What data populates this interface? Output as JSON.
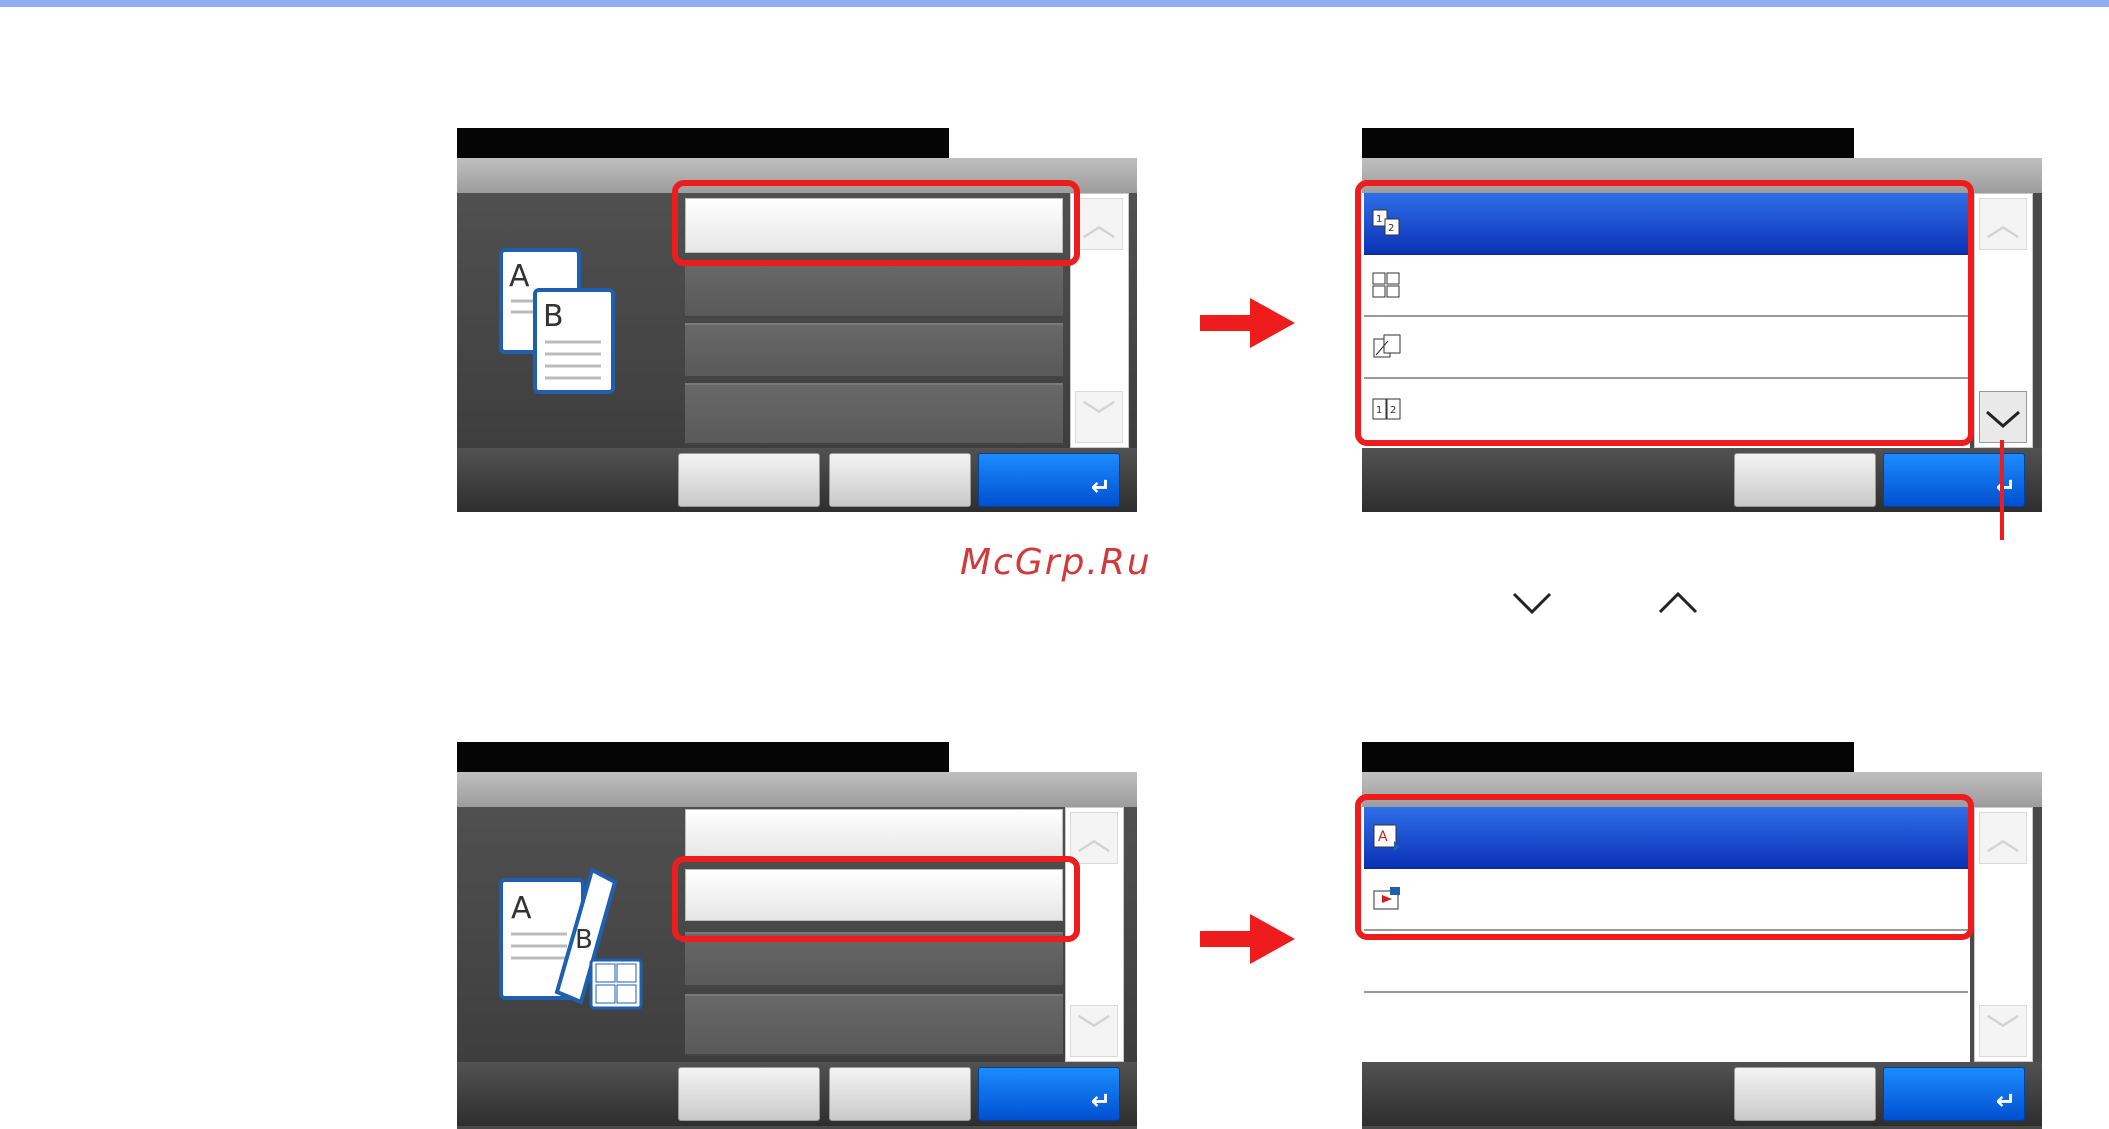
{
  "watermark": "McGrp.Ru",
  "colors": {
    "accent_red": "#ee1c1c",
    "selection_blue": "#0b33b8",
    "ok_blue": "#0060e0"
  },
  "icons": {
    "scroll_up": "chevron-up-icon",
    "scroll_down": "chevron-down-icon",
    "enter": "enter-icon",
    "between_text_down": "chevron-down-icon",
    "between_text_up": "chevron-up-icon"
  },
  "glyphs": {
    "up": "︿",
    "down": "﹀",
    "enter": "↵"
  }
}
